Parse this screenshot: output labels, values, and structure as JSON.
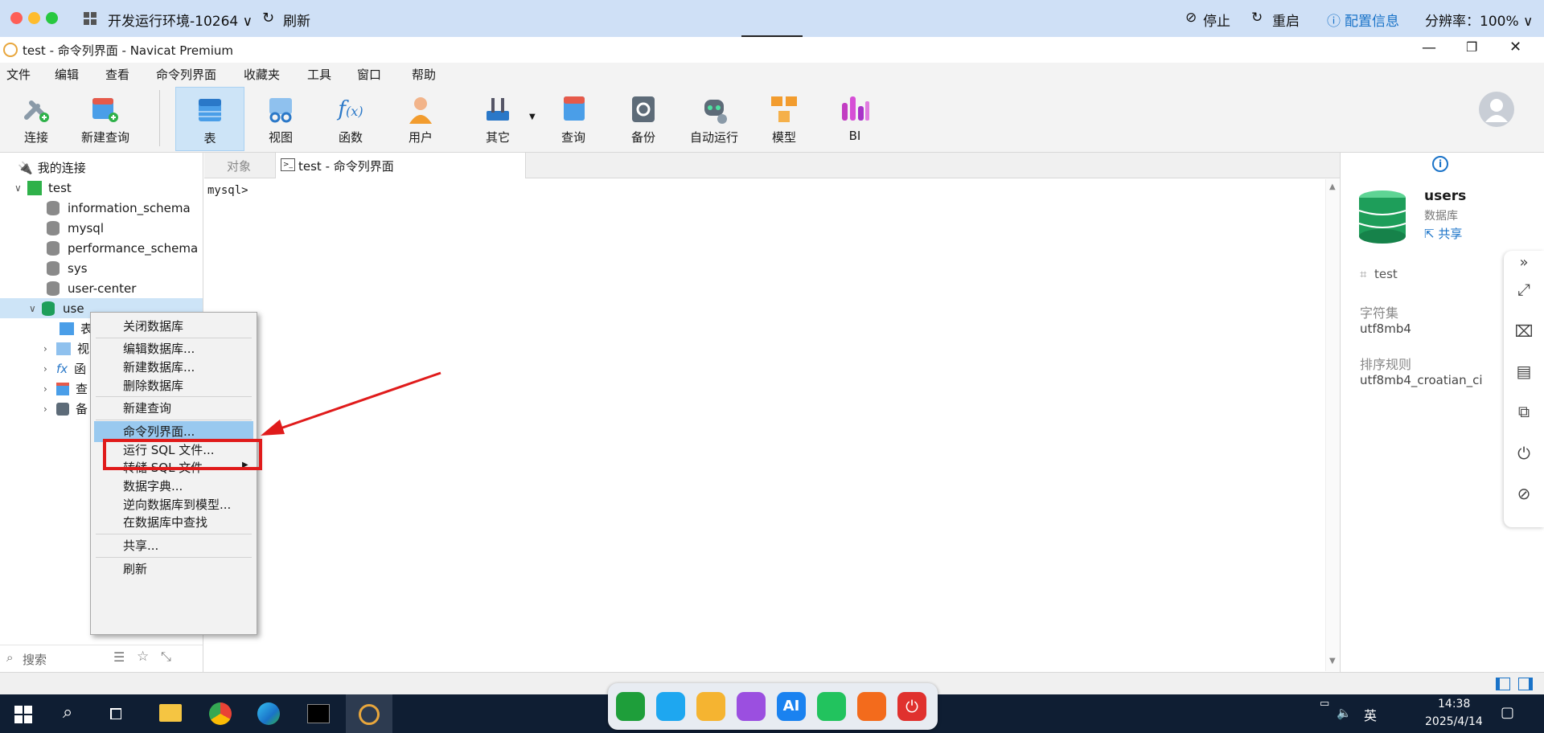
{
  "topbar": {
    "env_label": "开发运行环境-10264",
    "refresh": "刷新",
    "stop": "停止",
    "restart": "重启",
    "config": "配置信息",
    "resolution": "分辨率：100%"
  },
  "window": {
    "title": "test - 命令列界面 - Navicat Premium"
  },
  "menu": [
    "文件",
    "编辑",
    "查看",
    "命令列界面",
    "收藏夹",
    "工具",
    "窗口",
    "帮助"
  ],
  "toolbar": {
    "items": [
      "连接",
      "新建查询",
      "表",
      "视图",
      "函数",
      "用户",
      "其它",
      "查询",
      "备份",
      "自动运行",
      "模型",
      "BI"
    ]
  },
  "sidebar": {
    "root": "我的连接",
    "connection": "test",
    "databases": [
      "information_schema",
      "mysql",
      "performance_schema",
      "sys",
      "user-center",
      "use"
    ],
    "sub_labels": [
      "表",
      "视",
      "函",
      "查",
      "备"
    ],
    "search_placeholder": "搜索"
  },
  "tabs": {
    "objects": "对象",
    "active": "test - 命令列界面"
  },
  "editor": {
    "prompt": "mysql>"
  },
  "context_menu": {
    "items": [
      "关闭数据库",
      "编辑数据库...",
      "新建数据库...",
      "删除数据库",
      "新建查询",
      "命令列界面...",
      "运行 SQL 文件...",
      "转储 SQL 文件",
      "数据字典...",
      "逆向数据库到模型...",
      "在数据库中查找",
      "共享...",
      "刷新"
    ]
  },
  "info_panel": {
    "name": "users",
    "type": "数据库",
    "share": "共享",
    "connection": "test",
    "charset_label": "字符集",
    "charset_value": "utf8mb4",
    "collation_label": "排序规则",
    "collation_value": "utf8mb4_croatian_ci"
  },
  "taskbar": {
    "time": "14:38",
    "date": "2025/4/14",
    "ime": "英"
  },
  "colors": {
    "accent": "#1a73c8",
    "highlight": "#99c9ef",
    "annotation": "#e01b1b"
  }
}
